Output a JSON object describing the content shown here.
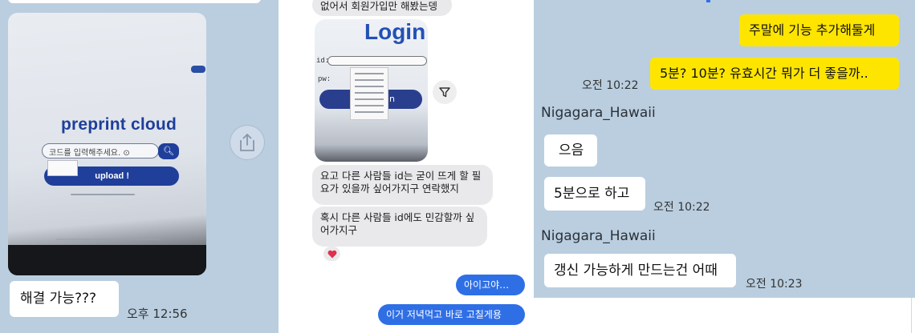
{
  "left_panel": {
    "photo": {
      "brand": "preprint cloud",
      "search_placeholder": "코드를 입력해주세요. ⊙",
      "upload_label": "upload !"
    },
    "message": "해결 가능???",
    "time": "오후 12:56",
    "share_icon": "share-icon"
  },
  "middle_panel": {
    "top_message": "없어서 회원가입만 해봤는뎅",
    "login_photo": {
      "title": "Login",
      "id_label": "id:",
      "pw_label": "pw:",
      "button_label": "gin"
    },
    "messages_in": [
      "요고 다른 사람들 id는 굳이 뜨게 할 필요가 있을까 싶어가지구 연락했지",
      "혹시 다른 사람들 id에도 민감할까 싶어가지구"
    ],
    "reaction": "❤️",
    "messages_out": [
      "아이고야…",
      "이거 저녁먹고 바로 고칠게용"
    ]
  },
  "right_panel": {
    "sent": [
      {
        "text": "주말에 기능 추가해둘게"
      },
      {
        "text": "5분? 10분? 유효시간 뭐가 더 좋을까..",
        "time": "오전 10:22"
      }
    ],
    "sender_name": "Nigagara_Hawaii",
    "received_group1": [
      {
        "text": "으음"
      },
      {
        "text": "5분으로 하고",
        "time": "오전 10:22"
      }
    ],
    "received_group2": [
      {
        "text": "갱신 가능하게 만드는건 어때",
        "time": "오전 10:23"
      }
    ]
  },
  "colors": {
    "kakao_bg": "#bacee0",
    "kakao_yellow": "#fee500",
    "imessage_blue": "#2f6fe6",
    "imessage_gray": "#e9e9eb"
  }
}
